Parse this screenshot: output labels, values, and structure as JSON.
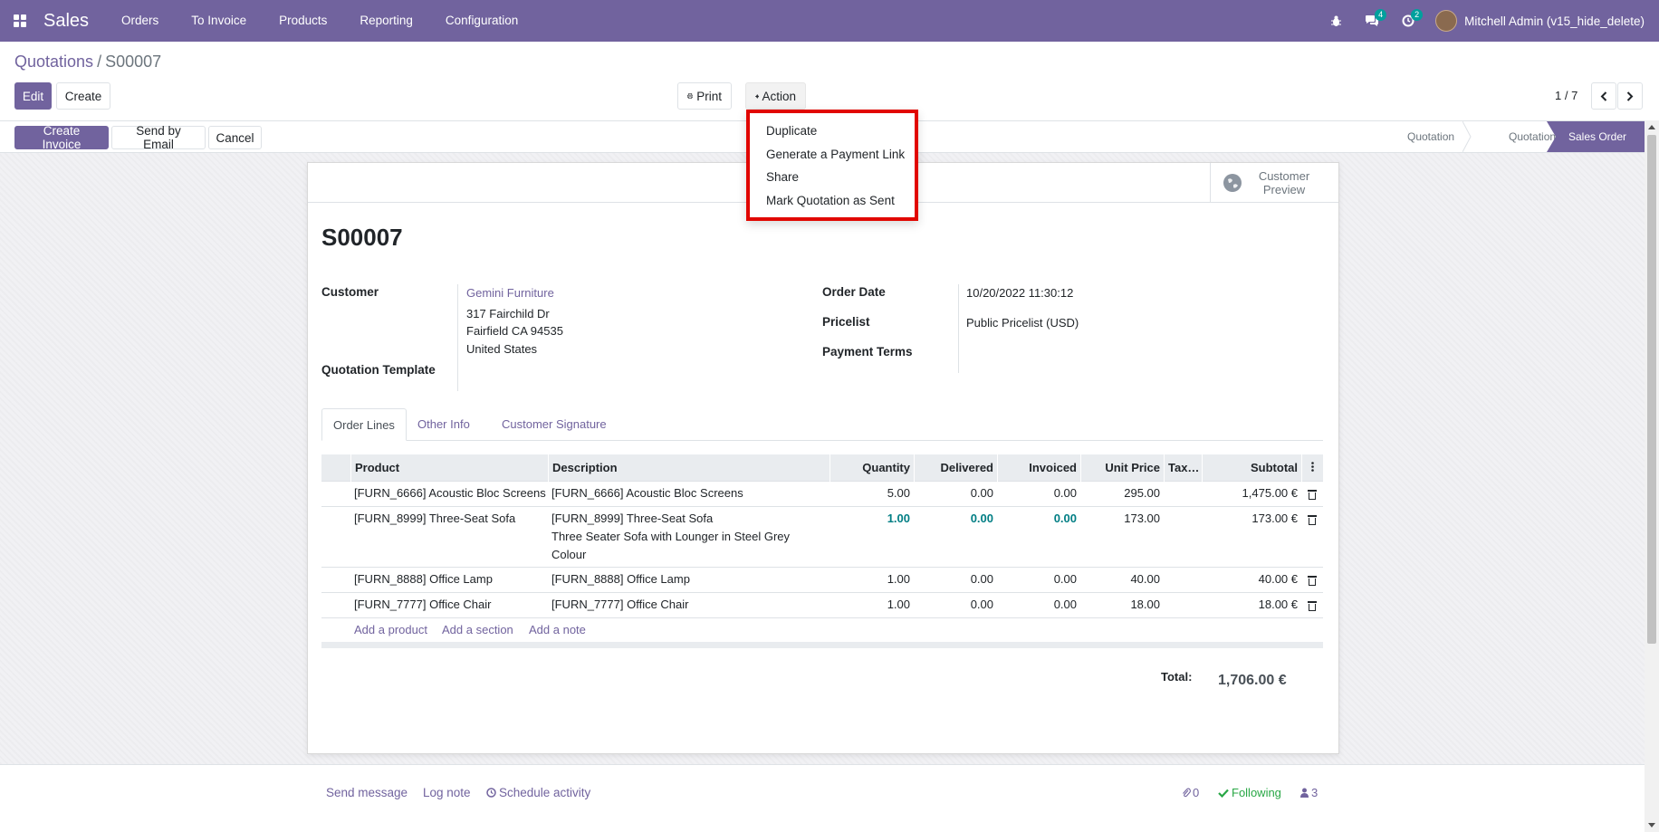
{
  "app": {
    "brand": "Sales",
    "menu": [
      "Orders",
      "To Invoice",
      "Products",
      "Reporting",
      "Configuration"
    ],
    "chat_badge": "4",
    "activity_badge": "2",
    "user_name": "Mitchell Admin (v15_hide_delete)"
  },
  "breadcrumb": {
    "parent": "Quotations",
    "separator": "/",
    "current": "S00007"
  },
  "toolbar": {
    "edit": "Edit",
    "create": "Create",
    "print": "Print",
    "action": "Action"
  },
  "pager": {
    "value": "1 / 7"
  },
  "statusbar": {
    "buttons": [
      "Create Invoice",
      "Send by Email",
      "Cancel"
    ],
    "stages": [
      "Quotation",
      "Quotation Sent",
      "Sales Order"
    ],
    "active_stage": "Sales Order"
  },
  "action_menu": {
    "items": [
      "Duplicate",
      "Generate a Payment Link",
      "Share",
      "Mark Quotation as Sent"
    ]
  },
  "form": {
    "preview_label": "Customer Preview",
    "title": "S00007",
    "customer_label": "Customer",
    "customer_name": "Gemini Furniture",
    "customer_address": [
      "317 Fairchild Dr",
      "Fairfield CA 94535",
      "United States"
    ],
    "template_label": "Quotation Template",
    "order_date_label": "Order Date",
    "order_date": "10/20/2022 11:30:12",
    "pricelist_label": "Pricelist",
    "pricelist": "Public Pricelist (USD)",
    "payment_terms_label": "Payment Terms"
  },
  "tabs": [
    "Order Lines",
    "Other Info",
    "Customer Signature"
  ],
  "order_lines": {
    "columns": [
      "Product",
      "Description",
      "Quantity",
      "Delivered",
      "Invoiced",
      "Unit Price",
      "Tax…",
      "Subtotal"
    ],
    "rows": [
      {
        "product": "[FURN_6666] Acoustic Bloc Screens",
        "description": [
          "[FURN_6666] Acoustic Bloc Screens"
        ],
        "quantity": "5.00",
        "delivered": "0.00",
        "invoiced": "0.00",
        "unit_price": "295.00",
        "taxes": "",
        "subtotal": "1,475.00 €"
      },
      {
        "product": "[FURN_8999] Three-Seat Sofa",
        "description": [
          "[FURN_8999] Three-Seat Sofa",
          "Three Seater Sofa with Lounger in Steel Grey",
          "Colour"
        ],
        "quantity": "1.00",
        "delivered": "0.00",
        "invoiced": "0.00",
        "unit_price": "173.00",
        "taxes": "",
        "subtotal": "173.00 €"
      },
      {
        "product": "[FURN_8888] Office Lamp",
        "description": [
          "[FURN_8888] Office Lamp"
        ],
        "quantity": "1.00",
        "delivered": "0.00",
        "invoiced": "0.00",
        "unit_price": "40.00",
        "taxes": "",
        "subtotal": "40.00 €"
      },
      {
        "product": "[FURN_7777] Office Chair",
        "description": [
          "[FURN_7777] Office Chair"
        ],
        "quantity": "1.00",
        "delivered": "0.00",
        "invoiced": "0.00",
        "unit_price": "18.00",
        "taxes": "",
        "subtotal": "18.00 €"
      }
    ],
    "add_links": [
      "Add a product",
      "Add a section",
      "Add a note"
    ]
  },
  "totals": {
    "label": "Total:",
    "value": "1,706.00 €"
  },
  "chatter": {
    "send_message": "Send message",
    "log_note": "Log note",
    "schedule_activity": "Schedule activity",
    "attachments": "0",
    "following": "Following",
    "followers": "3"
  },
  "colors": {
    "brand": "#71639e",
    "highlight_border": "#e10600",
    "highlight_number": "#017e84"
  }
}
